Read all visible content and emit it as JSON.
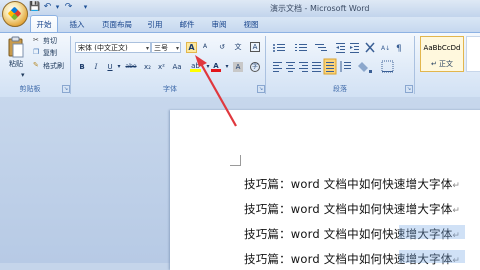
{
  "window": {
    "title": "演示文档 - Microsoft Word"
  },
  "quick_access": {
    "save": "💾",
    "undo": "↶",
    "undo_more": "▾",
    "redo": "↷",
    "customize": "▾"
  },
  "tabs": [
    "开始",
    "插入",
    "页面布局",
    "引用",
    "邮件",
    "审阅",
    "视图"
  ],
  "clipboard": {
    "paste": "粘贴",
    "cut": "剪切",
    "copy": "复制",
    "format_painter": "格式刷",
    "group": "剪贴板"
  },
  "font": {
    "name": "宋体 (中文正文)",
    "size": "三号",
    "grow_font": "A",
    "shrink_font": "A",
    "clear_format": "↺",
    "phonetic": "文",
    "border": "A",
    "bold": "B",
    "italic": "I",
    "underline": "U",
    "strike": "abe",
    "subscript": "x₂",
    "superscript": "x²",
    "case": "Aa",
    "highlight": "ab",
    "font_color": "A",
    "char_shading": "A",
    "enclose": "字",
    "group": "字体"
  },
  "paragraph": {
    "group": "段落"
  },
  "styles": {
    "normal_sample": "AaBbCcDd",
    "normal_name": "↵ 正文"
  },
  "document": {
    "lines": [
      "技巧篇：word 文档中如何快速增大字体",
      "技巧篇：word 文档中如何快速增大字体",
      "技巧篇：word 文档中如何快速增大字体",
      "技巧篇：word 文档中如何快速增大字体"
    ]
  },
  "annotation_color": "#e0383e"
}
